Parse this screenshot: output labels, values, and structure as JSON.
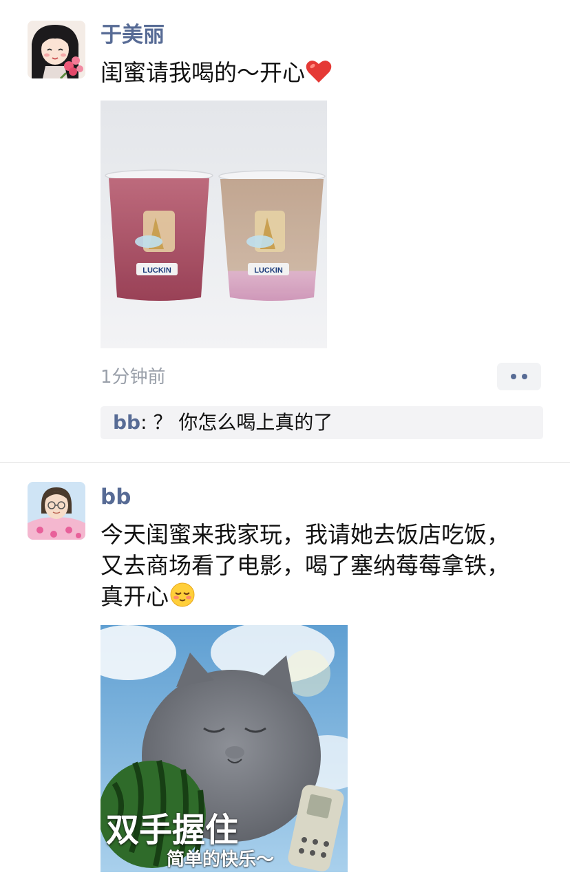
{
  "posts": [
    {
      "author": "于美丽",
      "text": "闺蜜请我喝的～开心",
      "text_emoji": "red-heart",
      "photo_labels": [
        "LUCKIN",
        "LUCKIN"
      ],
      "time": "1分钟前",
      "comment": {
        "user": "bb",
        "separator": ": ",
        "text": "？ 你怎么喝上真的了"
      }
    },
    {
      "author": "bb",
      "lines": [
        "今天闺蜜来我家玩，我请她去饭店吃饭，",
        "又去商场看了电影，喝了塞纳莓莓拿铁，",
        "真开心"
      ],
      "text_emoji": "shy-smile",
      "image_caption_main": "双手握住",
      "image_caption_sub": "简单的快乐～"
    }
  ],
  "colors": {
    "name_link": "#576b95",
    "time_gray": "#9aa0aa",
    "comment_bg": "#f3f3f5",
    "divider": "#e3e3e3"
  }
}
